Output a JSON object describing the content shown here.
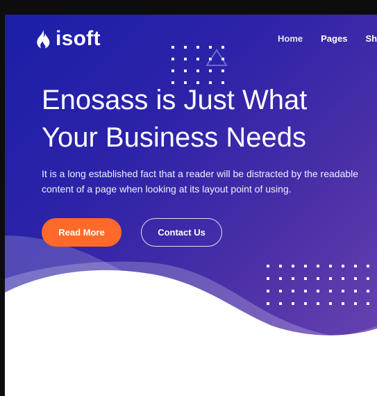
{
  "brand": {
    "name": "isoft",
    "icon": "flame-icon"
  },
  "nav": {
    "items": [
      "Home",
      "Pages",
      "Sho"
    ]
  },
  "hero": {
    "title": "Enosass is Just What Your Business Needs",
    "subtitle": "It is a long established fact that a reader will be distracted by the readable content of a page when looking at its layout point of using.",
    "primary_button": "Read More",
    "secondary_button": "Contact Us"
  },
  "colors": {
    "hero_gradient_start": "#1b1ea8",
    "hero_gradient_end": "#6e47b1",
    "accent": "#ff6a2a",
    "text": "#ffffff"
  }
}
